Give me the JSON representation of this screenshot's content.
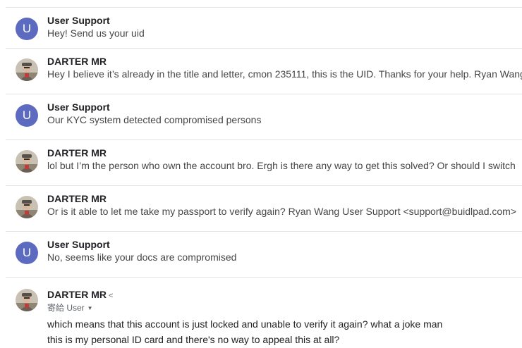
{
  "messages": [
    {
      "avatar": "letter",
      "initial": "U",
      "sender": "User Support",
      "snippet": "Hey! Send us your uid"
    },
    {
      "avatar": "photo",
      "sender": "DARTER MR",
      "snippet": "Hey I believe it’s already in the title and letter, cmon 235111, this is the UID. Thanks for your help. Ryan Wang"
    },
    {
      "avatar": "letter",
      "initial": "U",
      "sender": "User Support",
      "snippet": "Our KYC system detected compromised persons"
    },
    {
      "avatar": "photo",
      "sender": "DARTER MR",
      "snippet": "lol but I’m the person who own the account bro. Ergh is there any way to get this solved? Or should I switch"
    },
    {
      "avatar": "photo",
      "sender": "DARTER MR",
      "snippet": "Or is it able to let me take my passport to verify again? Ryan Wang User Support <support@buidlpad.com>"
    },
    {
      "avatar": "letter",
      "initial": "U",
      "sender": "User Support",
      "snippet": "No, seems like your docs are compromised"
    }
  ],
  "expanded": {
    "sender": "DARTER MR",
    "sender_chevron": "<",
    "recipient": "寄給 User",
    "recipient_caret": "▼",
    "body": [
      "which means that this account is just locked and unable to verify it again? what a joke man",
      "this is my personal ID card and there's no way to appeal this at all?"
    ]
  },
  "colors": {
    "avatar_letter_bg": "#5c6bc0",
    "divider": "#e4e4e4"
  }
}
